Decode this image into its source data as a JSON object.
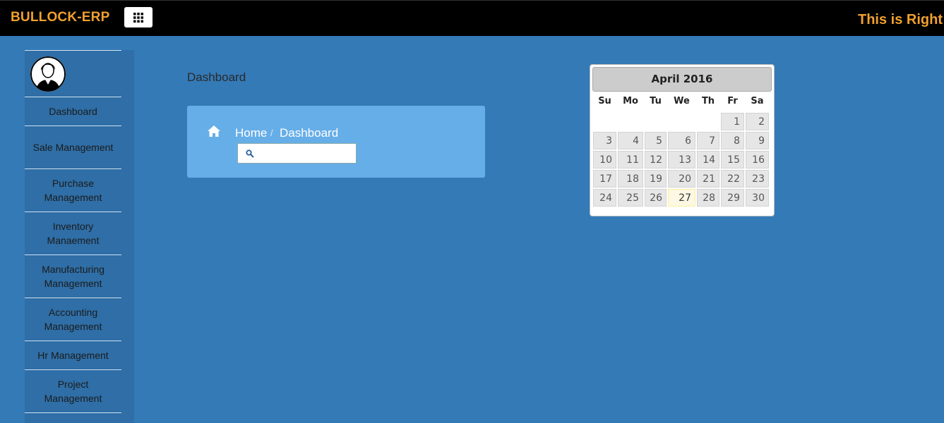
{
  "header": {
    "brand": "BULLOCK-ERP",
    "apps_icon": "grid-icon",
    "right_text": "This is Right"
  },
  "sidebar": {
    "avatar_icon": "user-avatar-icon",
    "items": [
      {
        "label": "Dashboard"
      },
      {
        "label": "Sale Management"
      },
      {
        "label": "Purchase Management"
      },
      {
        "label": "Inventory Manaement"
      },
      {
        "label": "Manufacturing Management"
      },
      {
        "label": "Accounting Management"
      },
      {
        "label": "Hr Management"
      },
      {
        "label": "Project Management"
      }
    ]
  },
  "main": {
    "page_title": "Dashboard",
    "breadcrumb": {
      "home": "Home",
      "separator": "/",
      "current": "Dashboard"
    },
    "search": {
      "value": "",
      "placeholder": ""
    }
  },
  "calendar": {
    "title": "April 2016",
    "weekdays": [
      "Su",
      "Mo",
      "Tu",
      "We",
      "Th",
      "Fr",
      "Sa"
    ],
    "weeks": [
      [
        "",
        "",
        "",
        "",
        "",
        "1",
        "2"
      ],
      [
        "3",
        "4",
        "5",
        "6",
        "7",
        "8",
        "9"
      ],
      [
        "10",
        "11",
        "12",
        "13",
        "14",
        "15",
        "16"
      ],
      [
        "17",
        "18",
        "19",
        "20",
        "21",
        "22",
        "23"
      ],
      [
        "24",
        "25",
        "26",
        "27",
        "28",
        "29",
        "30"
      ]
    ],
    "today": "27"
  },
  "colors": {
    "background": "#337ab7",
    "accent": "#f0a030",
    "panel": "#66aee8"
  }
}
